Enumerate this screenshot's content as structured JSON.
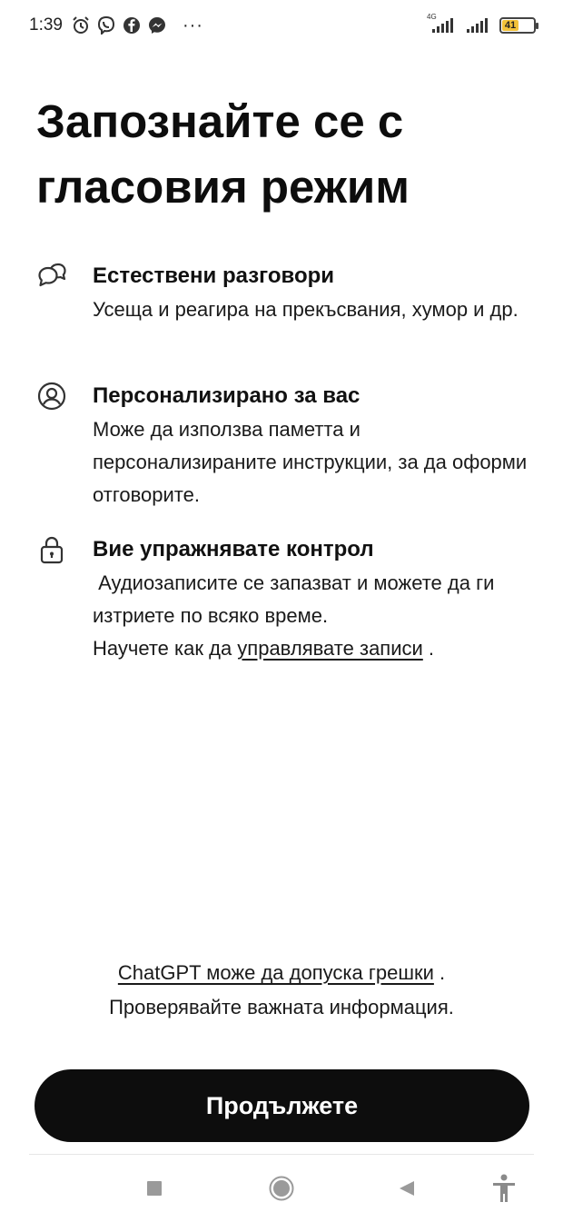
{
  "status_bar": {
    "time": "1:39",
    "icons": [
      "alarm-icon",
      "viber-icon",
      "facebook-icon",
      "messenger-icon"
    ],
    "more": "···",
    "network_label": "4G",
    "battery_level": "41",
    "battery_color": "#f2c23a"
  },
  "headline": {
    "line1": "Запознайте се с",
    "line2": "гласовия режим"
  },
  "features": [
    {
      "icon": "chat-bubbles-icon",
      "title": "Естествени разговори",
      "desc": "Усеща и реагира на прекъсвания, хумор и др."
    },
    {
      "icon": "user-circle-icon",
      "title": "Персонализирано за вас",
      "desc": "Може да използва паметта и персонализираните инструкции, за да оформи отговорите."
    },
    {
      "icon": "lock-icon",
      "title": "Вие упражнявате контрол",
      "desc_line1": " Аудиозаписите се запазват и можете да ги изтриете по всяко време.",
      "desc_prefix": "Научете как да ",
      "desc_link": "управлявате записи",
      "desc_suffix": " ."
    }
  ],
  "disclaimer": {
    "link": "ChatGPT може да допуска грешки",
    "link_suffix": " .",
    "line2": "Проверявайте важната информация."
  },
  "continue_button": {
    "label": "Продължете"
  },
  "nav_bar": {
    "buttons": [
      "recents-square-icon",
      "home-circle-icon",
      "back-triangle-icon",
      "accessibility-icon"
    ]
  },
  "colors": {
    "background": "#ffffff",
    "text": "#111111",
    "button": "#0d0d0d",
    "button_text": "#ffffff"
  }
}
